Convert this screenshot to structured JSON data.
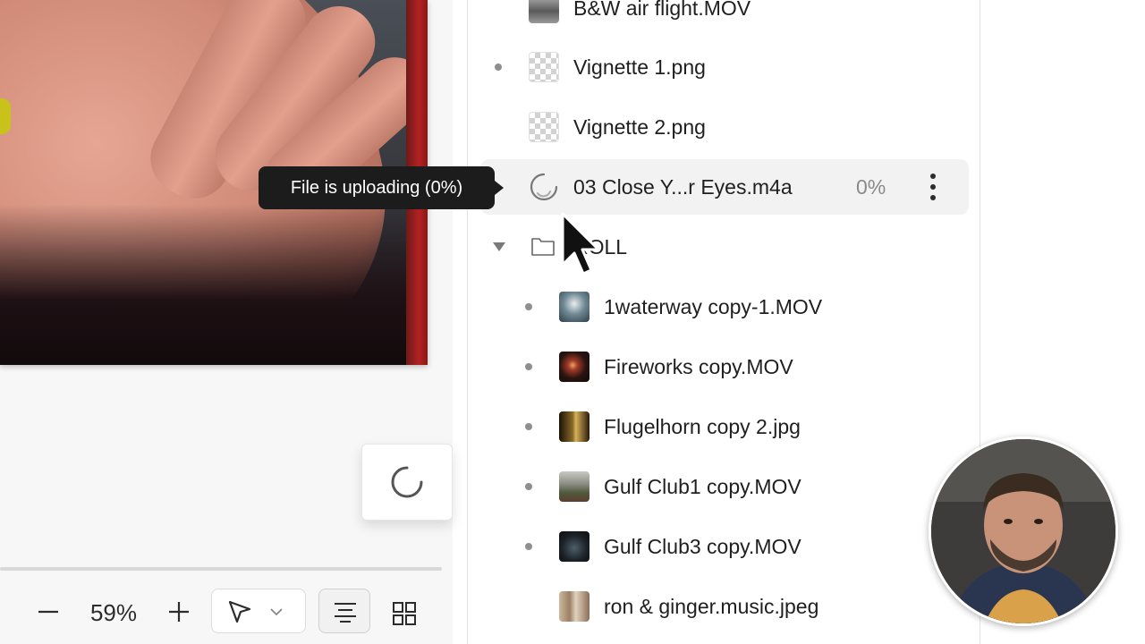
{
  "preview": {
    "tooltip_text": "File is uploading (0%)"
  },
  "toolbar": {
    "zoom_level": "59%",
    "zoom_out_icon": "minus-icon",
    "zoom_in_icon": "plus-icon",
    "pointer_tool_icon": "cursor-arrow-icon",
    "tool_dropdown_icon": "chevron-down-icon",
    "list_view_icon": "align-lines-icon",
    "grid_view_icon": "grid-icon"
  },
  "files": {
    "items": [
      {
        "name": "B&W air flight.MOV",
        "thumb": "bw-video",
        "dot": false
      },
      {
        "name": "Vignette 1.png",
        "thumb": "transparent",
        "dot": true
      },
      {
        "name": "Vignette 2.png",
        "thumb": "transparent",
        "dot": false
      },
      {
        "name": "03 Close Y...r Eyes.m4a",
        "thumb": "upload-spinner",
        "dot": false,
        "progress": "0%",
        "uploading": true
      },
      {
        "name": "ROLL",
        "thumb": "folder",
        "folder": true,
        "expanded": true
      },
      {
        "name": "1waterway copy-1.MOV",
        "thumb": "water-video",
        "dot": true
      },
      {
        "name": "Fireworks copy.MOV",
        "thumb": "fireworks-video",
        "dot": true
      },
      {
        "name": "Flugelhorn copy 2.jpg",
        "thumb": "flugelhorn-photo",
        "dot": true
      },
      {
        "name": "Gulf Club1 copy.MOV",
        "thumb": "club-video",
        "dot": true
      },
      {
        "name": "Gulf Club3 copy.MOV",
        "thumb": "club-night-video",
        "dot": true
      },
      {
        "name": "ron & ginger.music.jpeg",
        "thumb": "people-photo",
        "dot": false
      }
    ]
  },
  "colors": {
    "tooltip_bg": "#1c1c1c",
    "row_highlight": "#f2f2f2",
    "dot": "#8f8f8f",
    "progress_text": "#8a8a8a"
  }
}
